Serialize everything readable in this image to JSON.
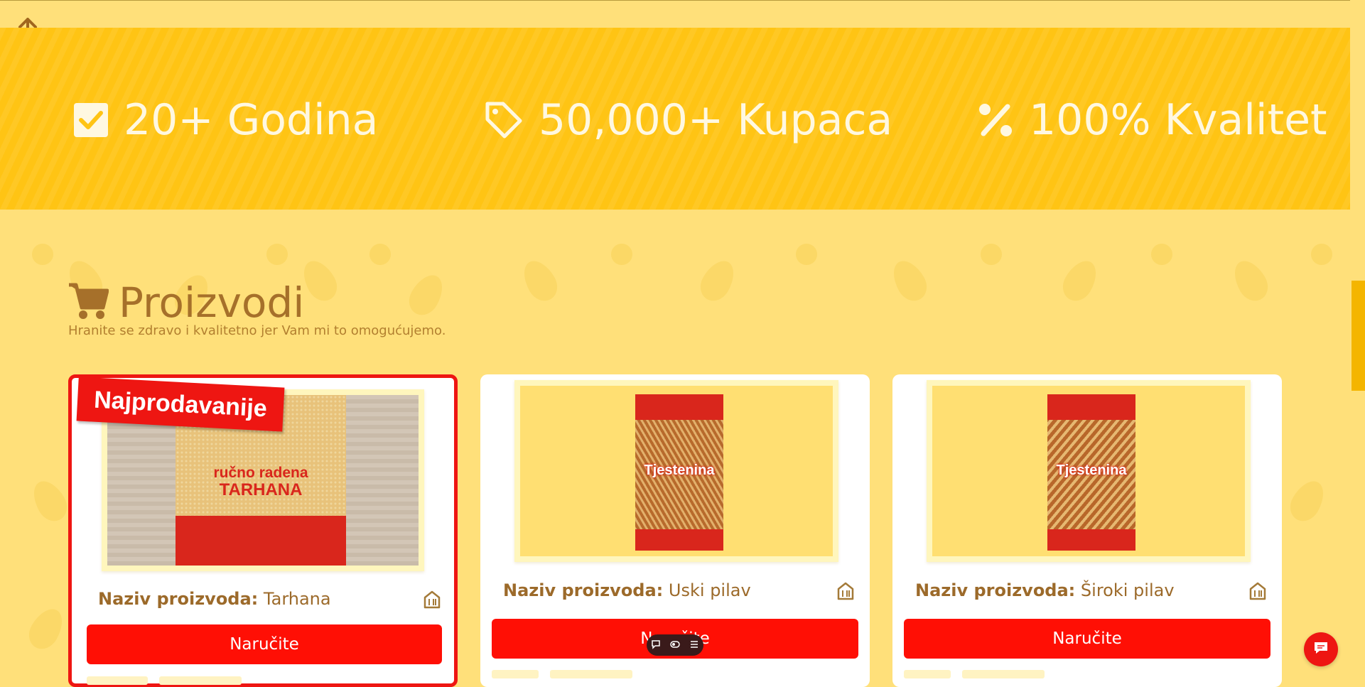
{
  "stats": [
    {
      "icon": "checkbox-icon",
      "text": "20+ Godina"
    },
    {
      "icon": "tag-icon",
      "text": "50,000+ Kupaca"
    },
    {
      "icon": "percent-icon",
      "text": "100% Kvalitet"
    }
  ],
  "products_section": {
    "title": "Proizvodi",
    "subtitle": "Hranite se zdravo i kvalitetno jer Vam mi to omogućujemo."
  },
  "products": [
    {
      "badge": "Najprodavanije",
      "name_label": "Naziv proizvoda:",
      "name": "Tarhana",
      "button": "Naručite",
      "package_text_1": "ručno radena",
      "package_text_2": "TARHANA"
    },
    {
      "name_label": "Naziv proizvoda:",
      "name": "Uski pilav",
      "button": "Naručite",
      "package_text_1": "Tjestenina"
    },
    {
      "name_label": "Naziv proizvoda:",
      "name": "Široki pilav",
      "button": "Naručite",
      "package_text_1": "Tjestenina"
    }
  ],
  "colors": {
    "accent_red": "#ee1612",
    "banner_yellow": "#ffc414",
    "background_yellow": "#ffe07a",
    "title_brown": "#a6702a"
  }
}
